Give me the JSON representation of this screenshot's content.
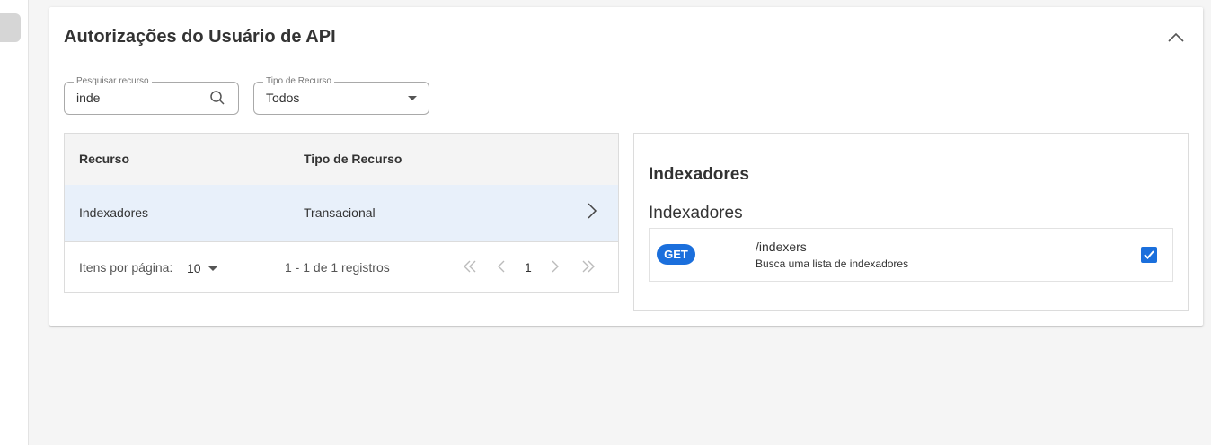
{
  "card": {
    "title": "Autorizações do Usuário de API"
  },
  "filters": {
    "search": {
      "label": "Pesquisar recurso",
      "value": "inde"
    },
    "type": {
      "label": "Tipo de Recurso",
      "value": "Todos"
    }
  },
  "table": {
    "columns": [
      "Recurso",
      "Tipo de Recurso"
    ],
    "rows": [
      {
        "resource": "Indexadores",
        "type": "Transacional"
      }
    ]
  },
  "paginator": {
    "items_label": "Itens por página:",
    "page_size": "10",
    "range": "1 - 1 de 1 registros",
    "current_page": "1"
  },
  "detail": {
    "title": "Indexadores",
    "subtitle": "Indexadores",
    "endpoints": [
      {
        "method": "GET",
        "path": "/indexers",
        "description": "Busca uma lista de indexadores",
        "checked": true
      }
    ]
  },
  "colors": {
    "accent": "#1b6fdc",
    "selected_row": "#e8f0fa"
  }
}
